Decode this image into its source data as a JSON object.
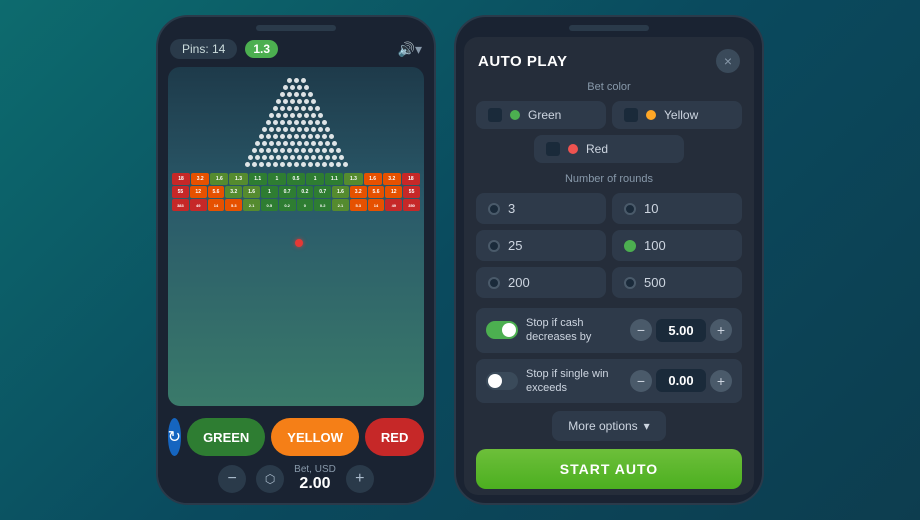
{
  "leftPhone": {
    "header": {
      "pins_label": "Pins: 14",
      "multiplier": "1.3"
    },
    "betControl": {
      "label": "Bet, USD",
      "value": "2.00"
    },
    "buttons": {
      "green": "GREEN",
      "yellow": "YELLOW",
      "red": "RED"
    }
  },
  "rightPhone": {
    "modal": {
      "title": "AUTO PLAY",
      "close": "×"
    },
    "betColor": {
      "label": "Bet color",
      "options": [
        {
          "name": "Green",
          "dot": "green"
        },
        {
          "name": "Yellow",
          "dot": "yellow"
        },
        {
          "name": "Red",
          "dot": "red"
        }
      ]
    },
    "rounds": {
      "label": "Number of rounds",
      "options": [
        "3",
        "10",
        "25",
        "100",
        "200",
        "500"
      ],
      "selected": "100"
    },
    "stopRules": [
      {
        "label": "Stop if cash decreases by",
        "amount": "5.00",
        "enabled": true
      },
      {
        "label": "Stop if single win exceeds",
        "amount": "0.00",
        "enabled": false
      }
    ],
    "moreOptions": "More options",
    "startAuto": "START AUTO"
  }
}
